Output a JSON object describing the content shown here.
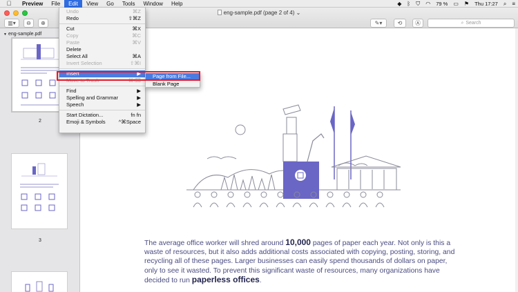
{
  "menubar": {
    "apple_glyph": "",
    "items": [
      {
        "label": "Preview"
      },
      {
        "label": "File"
      },
      {
        "label": "Edit"
      },
      {
        "label": "View"
      },
      {
        "label": "Go"
      },
      {
        "label": "Tools"
      },
      {
        "label": "Window"
      },
      {
        "label": "Help"
      }
    ],
    "battery": "79 %",
    "clock": "Thu 17:27"
  },
  "window": {
    "title": "eng-sample.pdf (page 2 of 4)",
    "search_placeholder": "Search"
  },
  "sidebar": {
    "file_label": "eng-sample.pdf",
    "page_numbers": [
      "2",
      "3"
    ]
  },
  "edit_menu": {
    "items": [
      {
        "label": "Undo",
        "shortcut": "⌘Z",
        "disabled": true
      },
      {
        "label": "Redo",
        "shortcut": "⇧⌘Z",
        "disabled": false
      },
      {
        "label": "Cut",
        "shortcut": "⌘X",
        "disabled": false
      },
      {
        "label": "Copy",
        "shortcut": "⌘C",
        "disabled": true
      },
      {
        "label": "Paste",
        "shortcut": "⌘V",
        "disabled": true
      },
      {
        "label": "Delete",
        "shortcut": "",
        "disabled": false
      },
      {
        "label": "Select All",
        "shortcut": "⌘A",
        "disabled": false
      },
      {
        "label": "Invert Selection",
        "shortcut": "⇧⌘I",
        "disabled": true
      },
      {
        "label": "Insert",
        "shortcut": "▶",
        "disabled": false,
        "highlighted": true
      },
      {
        "label": "Move to Trash",
        "shortcut": "⌘⌫",
        "disabled": true
      },
      {
        "label": "Find",
        "shortcut": "▶",
        "disabled": false
      },
      {
        "label": "Spelling and Grammar",
        "shortcut": "▶",
        "disabled": false
      },
      {
        "label": "Speech",
        "shortcut": "▶",
        "disabled": false
      },
      {
        "label": "Start Dictation...",
        "shortcut": "fn fn",
        "disabled": false
      },
      {
        "label": "Emoji & Symbols",
        "shortcut": "^⌘Space",
        "disabled": false
      }
    ]
  },
  "insert_submenu": {
    "items": [
      {
        "label": "Page from File...",
        "highlighted": true
      },
      {
        "label": "Blank Page",
        "highlighted": false
      }
    ]
  },
  "document": {
    "paragraph": {
      "p1": "The average office worker will shred around ",
      "b1": "10,000",
      "p2": " pages of paper each year. Not only is this a waste of resources, but it also adds additional costs associated with copying, posting, storing, and recycling all of these pages. Larger businesses can easily spend thousands of dollars on paper, only to see it wasted. To prevent this significant waste of resources, many organizations have decided to run ",
      "b2": "paperless offices",
      "p3": "."
    }
  },
  "colors": {
    "menu_highlight": "#4a7be0",
    "callout_red": "#e8152a",
    "illustration_purple": "#6a66c6"
  }
}
